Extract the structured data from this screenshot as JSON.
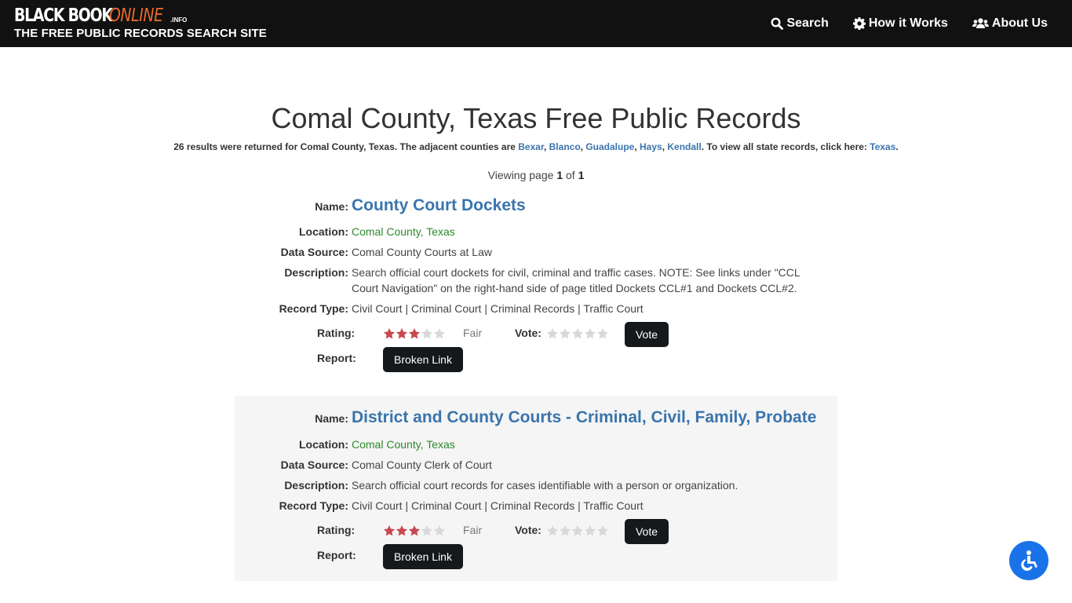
{
  "header": {
    "logo_black": "BLACK BOOK",
    "logo_online": "ONLINE",
    "logo_info": ".INFO",
    "tagline": "THE FREE PUBLIC RECORDS SEARCH SITE",
    "nav": [
      {
        "label": "Search",
        "icon": "search-icon"
      },
      {
        "label": "How it Works",
        "icon": "gear-icon"
      },
      {
        "label": "About Us",
        "icon": "users-icon"
      }
    ]
  },
  "page": {
    "title": "Comal County, Texas Free Public Records",
    "summary_prefix": "26 results were returned for Comal County, Texas. The adjacent counties are ",
    "adjacent_counties": [
      "Bexar",
      "Blanco",
      "Guadalupe",
      "Hays",
      "Kendall"
    ],
    "summary_mid": ". To view all state records, click here: ",
    "state_link": "Texas",
    "summary_suffix": ".",
    "pager_prefix": "Viewing page ",
    "current_page": "1",
    "pager_of": " of ",
    "total_pages": "1"
  },
  "labels": {
    "name": "Name:",
    "location": "Location:",
    "data_source": "Data Source:",
    "description": "Description:",
    "record_type": "Record Type:",
    "rating": "Rating:",
    "vote": "Vote:",
    "report": "Report:",
    "vote_button": "Vote",
    "broken_link_button": "Broken Link"
  },
  "records": [
    {
      "name": "County Court Dockets",
      "location": "Comal County, Texas",
      "data_source": "Comal County Courts at Law",
      "description": "Search official court dockets for civil, criminal and traffic cases. NOTE: See links under \"CCL Court Navigation\" on the right-hand side of page titled Dockets CCL#1 and Dockets CCL#2.",
      "record_type": "Civil Court | Criminal Court | Criminal Records | Traffic Court",
      "rating": 3,
      "rating_max": 5,
      "rating_text": "Fair"
    },
    {
      "name": "District and County Courts - Criminal, Civil, Family, Probate",
      "location": "Comal County, Texas",
      "data_source": "Comal County Clerk of Court",
      "description": "Search official court records for cases identifiable with a person or organization.",
      "record_type": "Civil Court | Criminal Court | Criminal Records | Traffic Court",
      "rating": 3,
      "rating_max": 5,
      "rating_text": "Fair"
    }
  ],
  "colors": {
    "header_bg": "#111111",
    "logo_accent": "#e96a2c",
    "link": "#3a74ad",
    "location": "#2c8a2c",
    "star_on": "#c9484f",
    "star_off": "#d8d8d8",
    "button_bg": "#15191c",
    "accessibility": "#1a72e8"
  }
}
